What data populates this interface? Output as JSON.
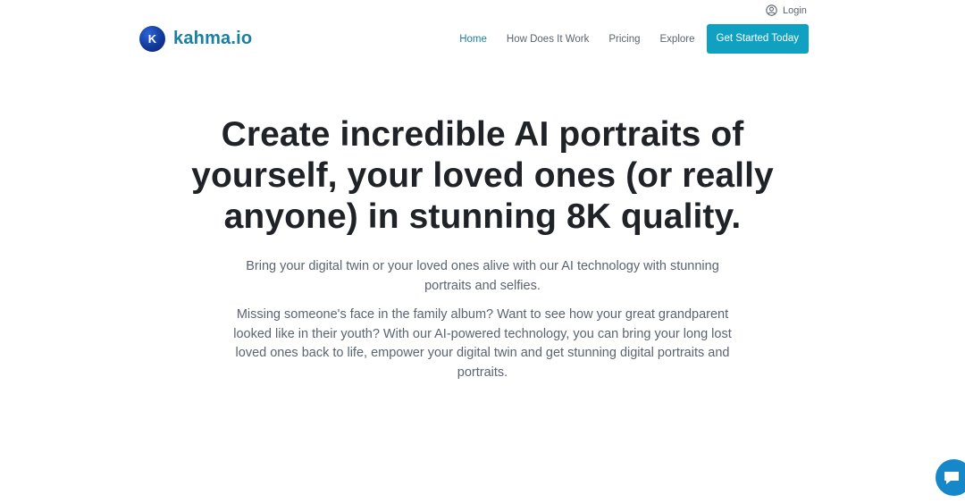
{
  "header": {
    "login_label": "Login",
    "logo_letter": "K",
    "logo_text": "kahma.io",
    "brand_color": "#1a7fa0",
    "nav": [
      {
        "label": "Home",
        "active": true
      },
      {
        "label": "How Does It Work",
        "active": false
      },
      {
        "label": "Pricing",
        "active": false
      },
      {
        "label": "Explore",
        "active": false
      }
    ],
    "cta_label": "Get Started Today",
    "cta_color": "#10a0c2"
  },
  "hero": {
    "title": "Create incredible AI portraits of yourself, your loved ones (or really anyone) in stunning 8K quality.",
    "subtitle": "Bring your digital twin or your loved ones alive with our AI technology with stunning portraits and selfies.",
    "body": "Missing someone's face in the family album? Want to see how your great grandparent looked like in their youth? With our AI-powered technology, you can bring your long lost loved ones back to life, empower your digital twin and get stunning digital portraits and portraits."
  },
  "icons": {
    "login": "user-circle-icon",
    "chat": "chat-icon"
  }
}
